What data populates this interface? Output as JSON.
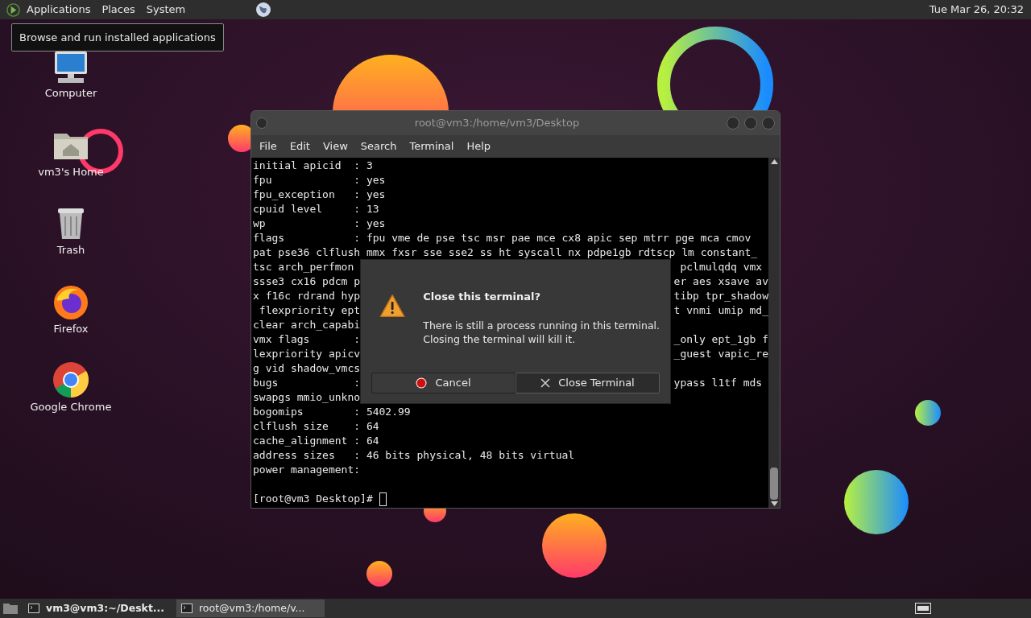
{
  "top_panel": {
    "menus": [
      {
        "label": "Applications"
      },
      {
        "label": "Places"
      },
      {
        "label": "System"
      }
    ],
    "clock": "Tue Mar 26, 20:32",
    "tooltip": "Browse and run installed applications"
  },
  "desktop_icons": [
    {
      "label": "Computer",
      "kind": "computer"
    },
    {
      "label": "vm3's Home",
      "kind": "home"
    },
    {
      "label": "Trash",
      "kind": "trash"
    },
    {
      "label": "Firefox",
      "kind": "firefox"
    },
    {
      "label": "Google Chrome",
      "kind": "chrome"
    }
  ],
  "terminal": {
    "title": "root@vm3:/home/vm3/Desktop",
    "menu": [
      "File",
      "Edit",
      "View",
      "Search",
      "Terminal",
      "Help"
    ],
    "lines": [
      {
        "left": "initial apicid  : 3"
      },
      {
        "left": "fpu             : yes"
      },
      {
        "left": "fpu_exception   : yes"
      },
      {
        "left": "cpuid level     : 13"
      },
      {
        "left": "wp              : yes"
      },
      {
        "left": "flags           : fpu vme de pse tsc msr pae mce cx8 apic sep mtrr pge mca cmov"
      },
      {
        "left": "pat pse36 clflush mmx fxsr sse sse2 ss ht syscall nx pdpe1gb rdtscp lm constant_"
      },
      {
        "left": "tsc arch_perfmon",
        "right": "pclmulqdq vmx "
      },
      {
        "left": "ssse3 cx16 pdcm p",
        "right": "er aes xsave av"
      },
      {
        "left": "x f16c rdrand hyp",
        "right": "tibp tpr_shadow"
      },
      {
        "left": " flexpriority ept",
        "right": "t vnmi umip md_"
      },
      {
        "left": "clear arch_capabi"
      },
      {
        "left": "vmx flags       :",
        "right": "_only ept_1gb f"
      },
      {
        "left": "lexpriority apicv",
        "right": "_guest vapic_re"
      },
      {
        "left": "g vid shadow_vmcs"
      },
      {
        "left": "bugs            :",
        "right": "ypass l1tf mds "
      },
      {
        "left": "swapgs mmio_unkno"
      },
      {
        "left": "bogomips        : 5402.99"
      },
      {
        "left": "clflush size    : 64"
      },
      {
        "left": "cache_alignment : 64"
      },
      {
        "left": "address sizes   : 46 bits physical, 48 bits virtual"
      },
      {
        "left": "power management:"
      }
    ],
    "prompt": "[root@vm3 Desktop]# "
  },
  "dialog": {
    "title": "Close this terminal?",
    "message": [
      "There is still a process running in this terminal.",
      "Closing the terminal will kill it."
    ],
    "buttons": [
      {
        "label": "Cancel",
        "kind": "cancel",
        "focused": false
      },
      {
        "label": "Close Terminal",
        "kind": "close",
        "focused": true
      }
    ]
  },
  "taskbar": {
    "items": [
      {
        "label": "vm3@vm3:~/Deskt...",
        "selected": false,
        "attention": true
      },
      {
        "label": "root@vm3:/home/v...",
        "selected": true,
        "attention": false
      }
    ]
  }
}
